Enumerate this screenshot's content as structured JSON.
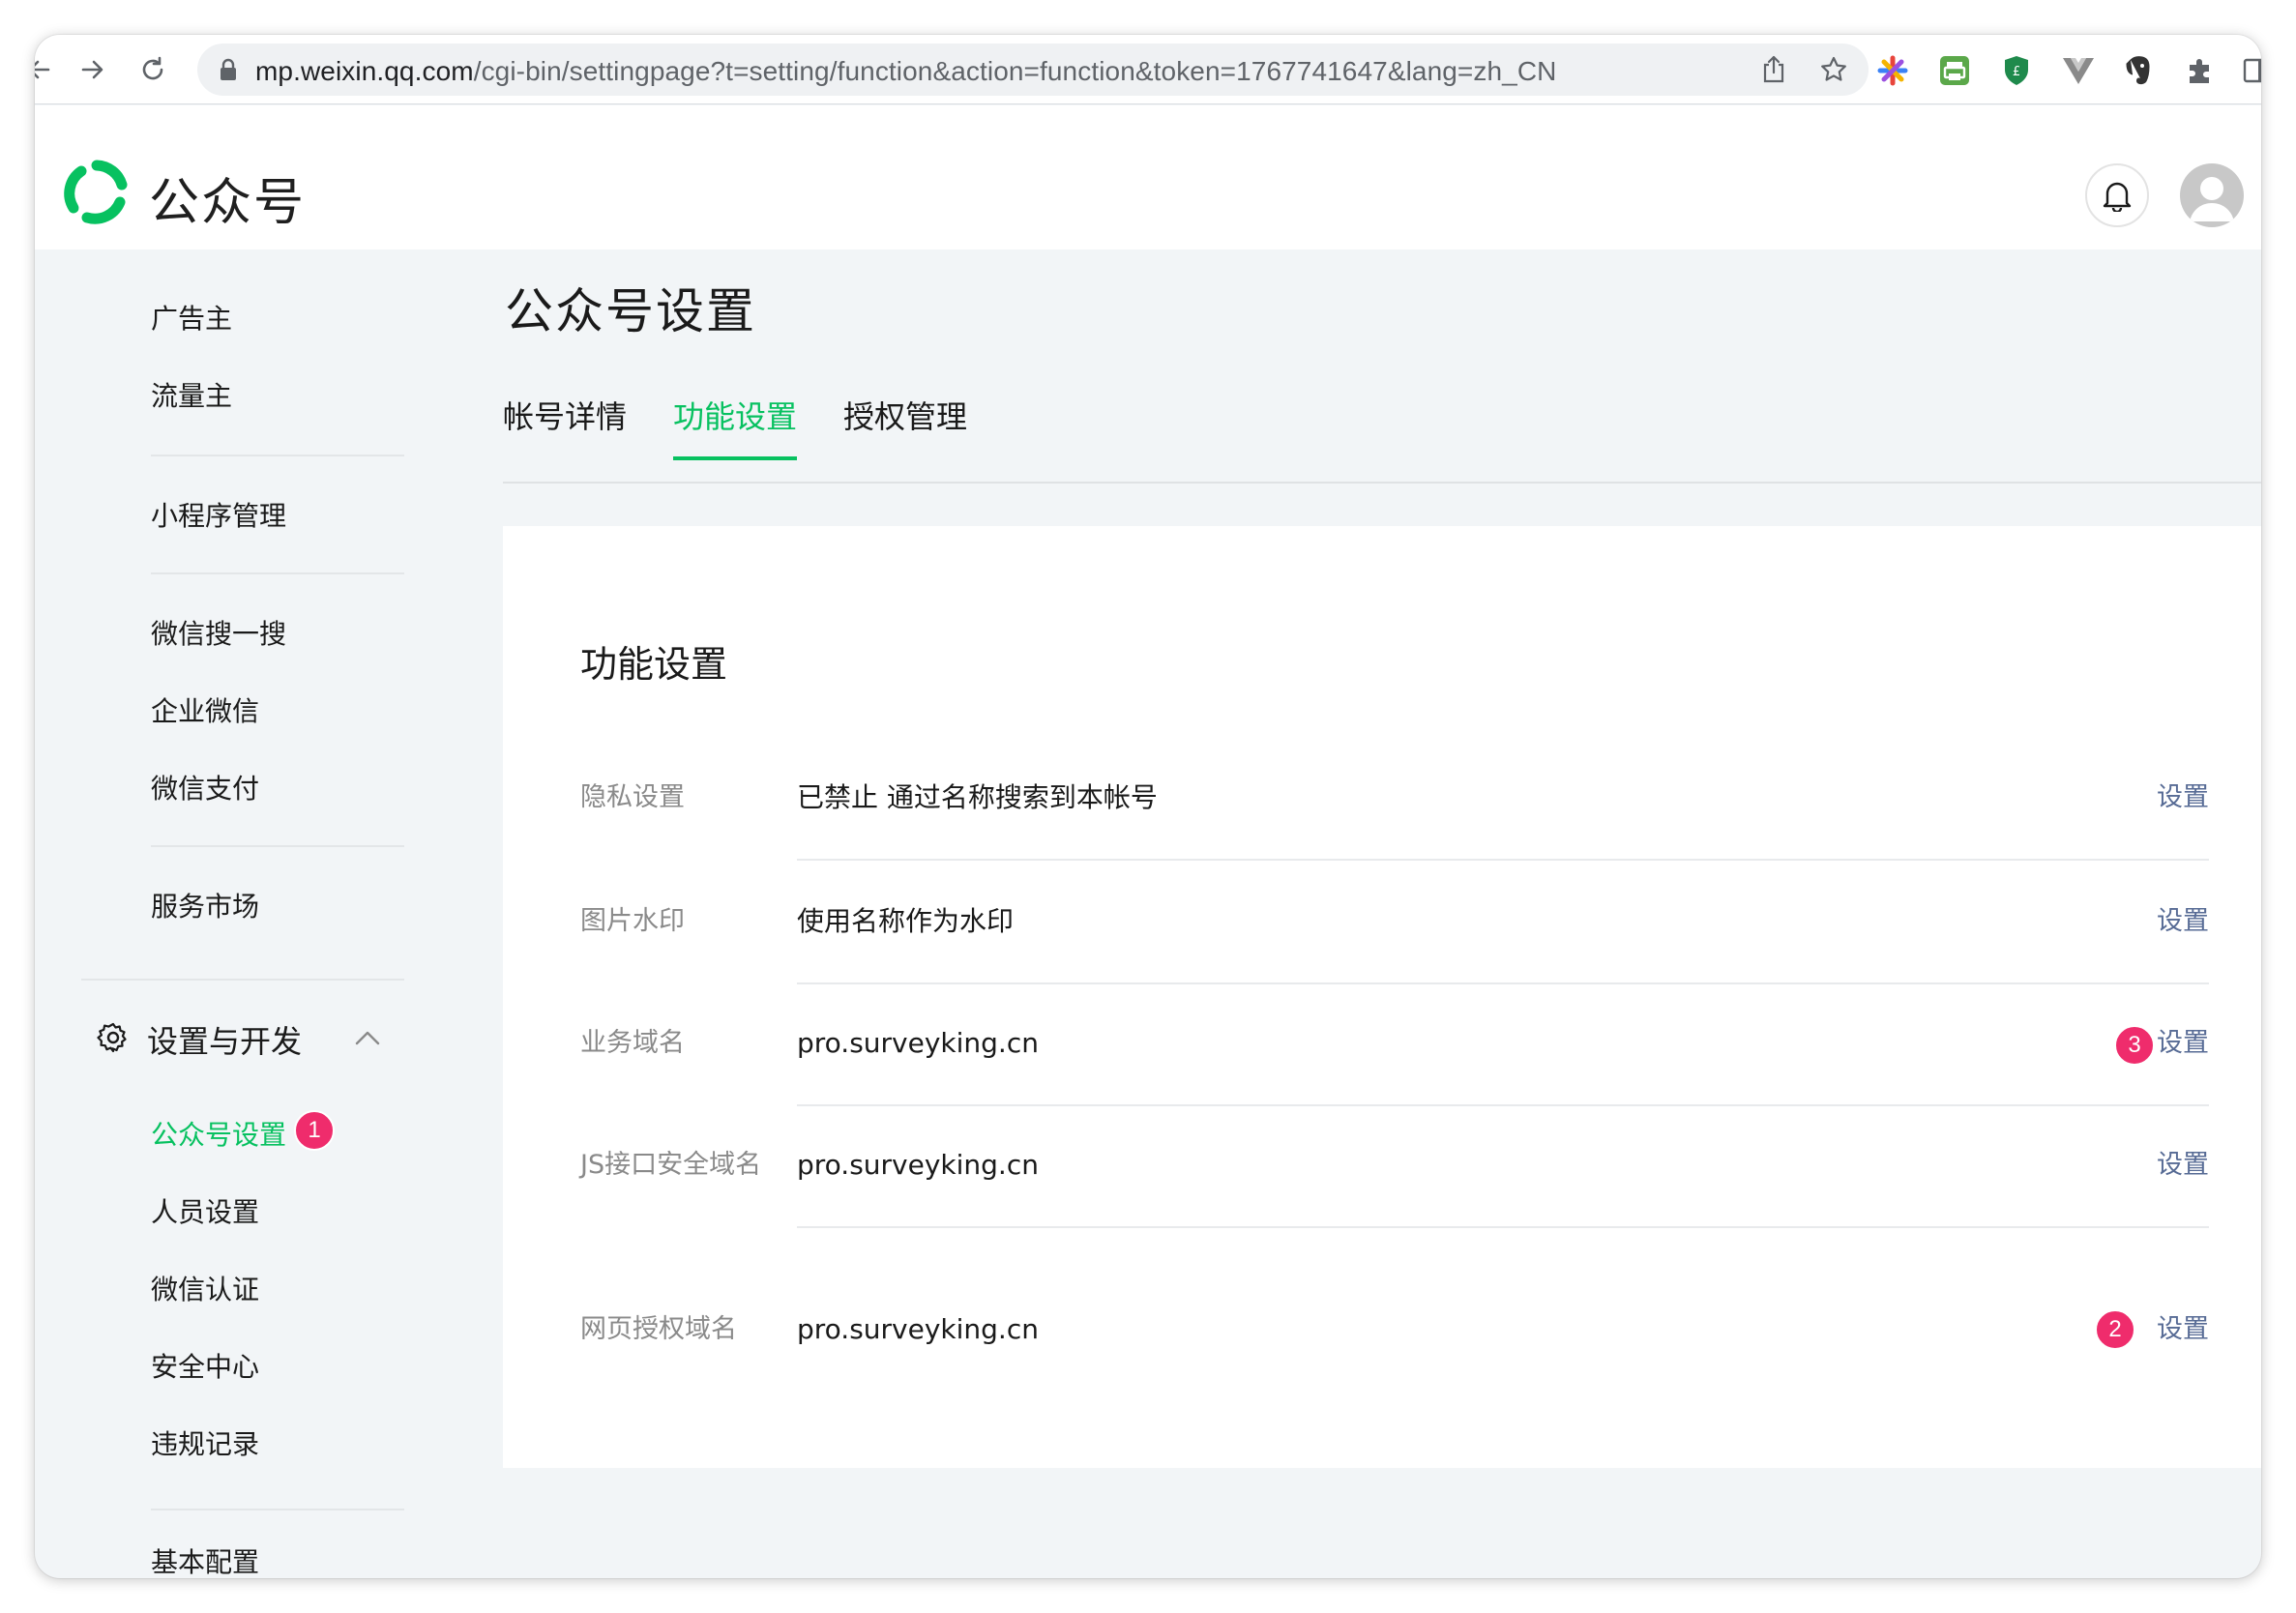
{
  "browser": {
    "url_host": "mp.weixin.qq.com",
    "url_path": "/cgi-bin/settingpage?t=setting/function&action=function&token=1767741647&lang=zh_CN"
  },
  "header": {
    "logo_text": "公众号",
    "brand_color": "#07c160"
  },
  "sidebar": {
    "group1": [
      "广告主",
      "流量主"
    ],
    "group2": [
      "小程序管理"
    ],
    "group3": [
      "微信搜一搜",
      "企业微信",
      "微信支付"
    ],
    "group4": [
      "服务市场"
    ],
    "section_title": "设置与开发",
    "section_items": [
      "公众号设置",
      "人员设置",
      "微信认证",
      "安全中心",
      "违规记录"
    ],
    "bottom_item": "基本配置",
    "active_item": "公众号设置"
  },
  "main": {
    "page_title": "公众号设置",
    "tabs": [
      "帐号详情",
      "功能设置",
      "授权管理"
    ],
    "active_tab": "功能设置",
    "card_title": "功能设置",
    "rows": [
      {
        "label": "隐私设置",
        "value": "已禁止 通过名称搜索到本帐号",
        "action": "设置"
      },
      {
        "label": "图片水印",
        "value": "使用名称作为水印",
        "action": "设置"
      },
      {
        "label": "业务域名",
        "value": "pro.surveyking.cn",
        "action": "设置"
      },
      {
        "label": "JS接口安全域名",
        "value": "pro.surveyking.cn",
        "action": "设置"
      },
      {
        "label": "网页授权域名",
        "value": "pro.surveyking.cn",
        "action": "设置"
      }
    ]
  },
  "annotations": {
    "badge_1": "1",
    "badge_2": "2",
    "badge_3": "3",
    "badge_color": "#ef2c6c"
  }
}
